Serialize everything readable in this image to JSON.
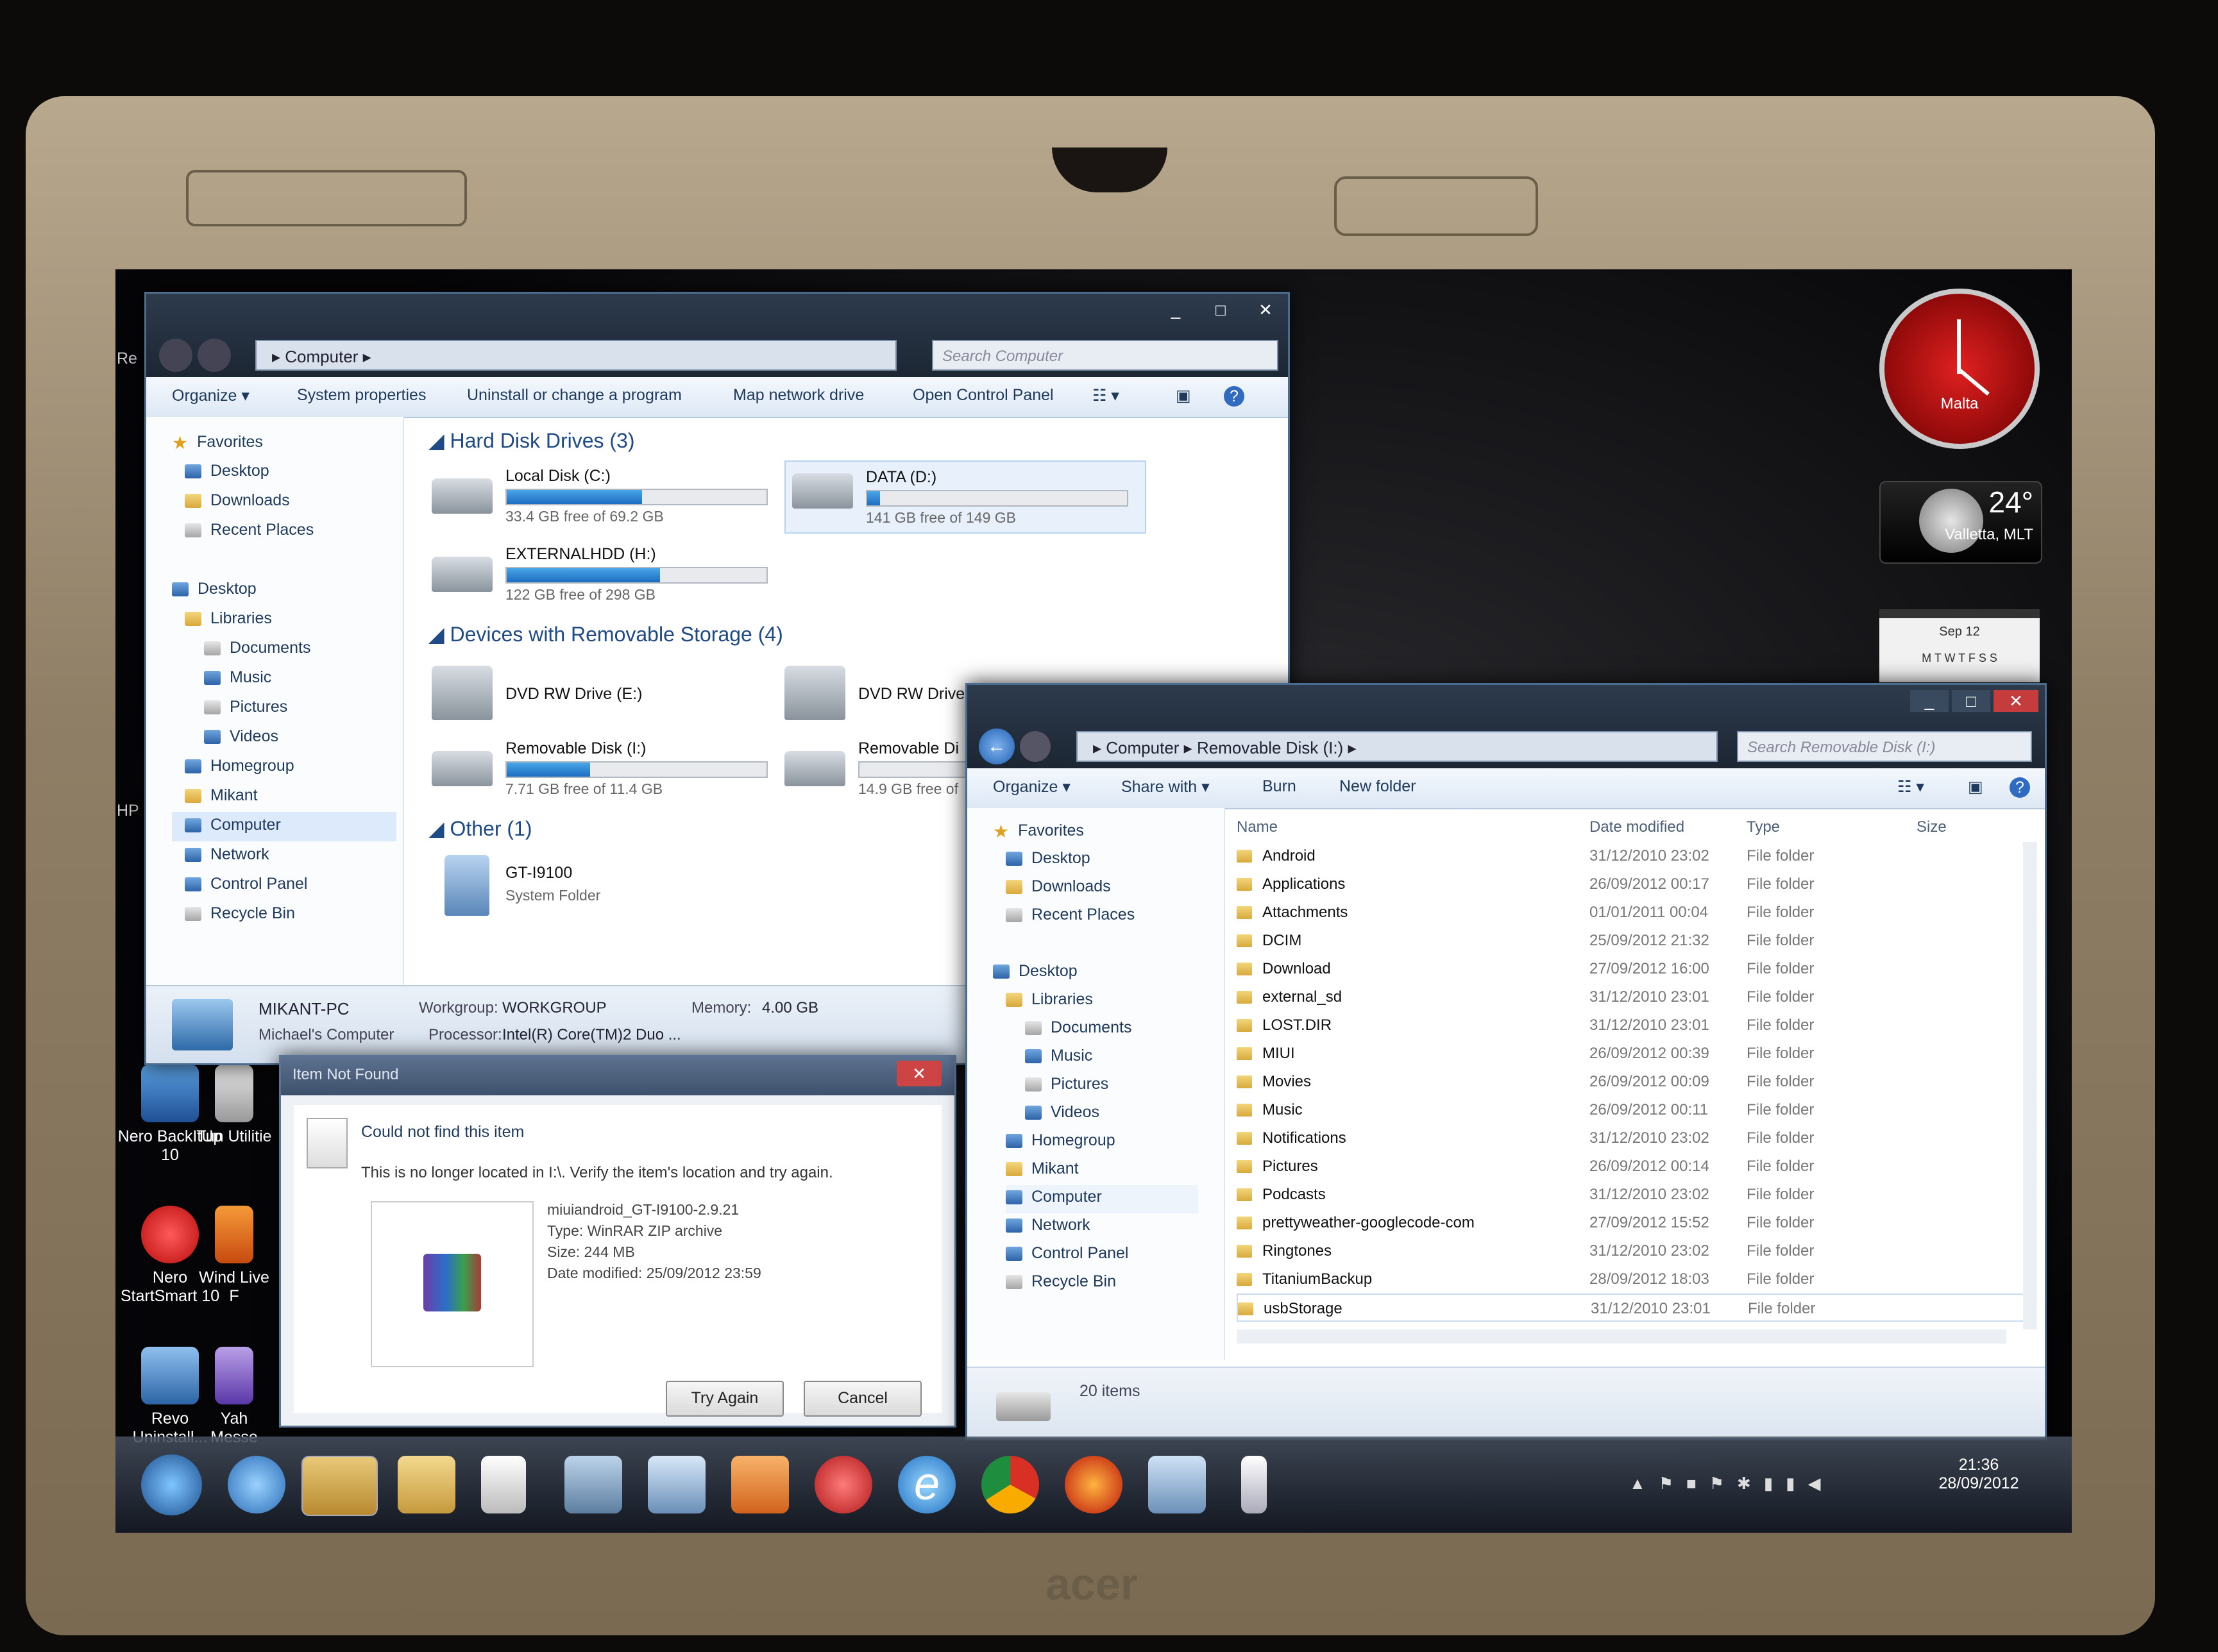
{
  "brand": "acer",
  "computer_window": {
    "breadcrumb": "Computer",
    "search_placeholder": "Search Computer",
    "toolbar": [
      "Organize",
      "System properties",
      "Uninstall or change a program",
      "Map network drive",
      "Open Control Panel"
    ],
    "nav": {
      "favorites": "Favorites",
      "desktop_fav": "Desktop",
      "downloads": "Downloads",
      "recent": "Recent Places",
      "desktop": "Desktop",
      "libraries": "Libraries",
      "documents": "Documents",
      "music": "Music",
      "pictures": "Pictures",
      "videos": "Videos",
      "homegroup": "Homegroup",
      "mikant": "Mikant",
      "computer": "Computer",
      "network": "Network",
      "control_panel": "Control Panel",
      "recycle_bin": "Recycle Bin"
    },
    "sections": {
      "hdd": "Hard Disk Drives (3)",
      "removable": "Devices with Removable Storage (4)",
      "other": "Other (1)"
    },
    "drives": [
      {
        "name": "Local Disk (C:)",
        "free": "33.4 GB free of 69.2 GB",
        "used_fraction": 0.52
      },
      {
        "name": "DATA (D:)",
        "free": "141 GB free of 149 GB",
        "used_fraction": 0.05
      },
      {
        "name": "EXTERNALHDD (H:)",
        "free": "122 GB free of 298 GB",
        "used_fraction": 0.59
      }
    ],
    "removable": [
      {
        "name": "DVD RW Drive (E:)"
      },
      {
        "name": "DVD RW Drive"
      },
      {
        "name": "Removable Disk (I:)",
        "free": "7.71 GB free of 11.4 GB",
        "used_fraction": 0.32
      },
      {
        "name": "Removable Di",
        "free": "14.9 GB free of",
        "used_fraction": 0.0
      }
    ],
    "other": {
      "name": "GT-I9100",
      "type": "System Folder"
    },
    "details": {
      "pc_name": "MIKANT-PC",
      "pc_desc": "Michael's Computer",
      "workgroup_label": "Workgroup:",
      "workgroup": "WORKGROUP",
      "memory_label": "Memory:",
      "memory": "4.00 GB",
      "processor_label": "Processor:",
      "processor": "Intel(R) Core(TM)2 Duo ..."
    }
  },
  "dialog": {
    "title": "Item Not Found",
    "heading": "Could not find this item",
    "message": "This is no longer located in I:\\. Verify the item's location and try again.",
    "file_name": "miuiandroid_GT-I9100-2.9.21",
    "file_type": "Type: WinRAR ZIP archive",
    "file_size": "Size: 244 MB",
    "file_date": "Date modified: 25/09/2012 23:59",
    "try_again": "Try Again",
    "cancel": "Cancel"
  },
  "removable_window": {
    "breadcrumb": [
      "Computer",
      "Removable Disk (I:)"
    ],
    "search_placeholder": "Search Removable Disk (I:)",
    "toolbar": [
      "Organize",
      "Share with",
      "Burn",
      "New folder"
    ],
    "columns": [
      "Name",
      "Date modified",
      "Type",
      "Size"
    ],
    "rows": [
      {
        "name": "Android",
        "date": "31/12/2010 23:02",
        "type": "File folder"
      },
      {
        "name": "Applications",
        "date": "26/09/2012 00:17",
        "type": "File folder"
      },
      {
        "name": "Attachments",
        "date": "01/01/2011 00:04",
        "type": "File folder"
      },
      {
        "name": "DCIM",
        "date": "25/09/2012 21:32",
        "type": "File folder"
      },
      {
        "name": "Download",
        "date": "27/09/2012 16:00",
        "type": "File folder"
      },
      {
        "name": "external_sd",
        "date": "31/12/2010 23:01",
        "type": "File folder"
      },
      {
        "name": "LOST.DIR",
        "date": "31/12/2010 23:01",
        "type": "File folder"
      },
      {
        "name": "MIUI",
        "date": "26/09/2012 00:39",
        "type": "File folder"
      },
      {
        "name": "Movies",
        "date": "26/09/2012 00:09",
        "type": "File folder"
      },
      {
        "name": "Music",
        "date": "26/09/2012 00:11",
        "type": "File folder"
      },
      {
        "name": "Notifications",
        "date": "31/12/2010 23:02",
        "type": "File folder"
      },
      {
        "name": "Pictures",
        "date": "26/09/2012 00:14",
        "type": "File folder"
      },
      {
        "name": "Podcasts",
        "date": "31/12/2010 23:02",
        "type": "File folder"
      },
      {
        "name": "prettyweather-googlecode-com",
        "date": "27/09/2012 15:52",
        "type": "File folder"
      },
      {
        "name": "Ringtones",
        "date": "31/12/2010 23:02",
        "type": "File folder"
      },
      {
        "name": "TitaniumBackup",
        "date": "28/09/2012 18:03",
        "type": "File folder"
      },
      {
        "name": "usbStorage",
        "date": "31/12/2010 23:01",
        "type": "File folder"
      }
    ],
    "status": "20 items"
  },
  "desktop_icons": [
    {
      "label": "Nero BackItUp 10"
    },
    {
      "label": "Tun Utilitie"
    },
    {
      "label": "Nero StartSmart 10"
    },
    {
      "label": "Wind Live F"
    },
    {
      "label": "Revo Uninstall..."
    },
    {
      "label": "Yah Messe"
    }
  ],
  "edge_labels": {
    "re": "Re",
    "hp": "HP"
  },
  "gadgets": {
    "clock_city": "Malta",
    "temperature": "24°",
    "weather_city": "Valletta, MLT",
    "calendar_month": "Sep 12",
    "calendar_days": "M T W T F S S"
  },
  "taskbar": {
    "time": "21:36",
    "date": "28/09/2012"
  }
}
